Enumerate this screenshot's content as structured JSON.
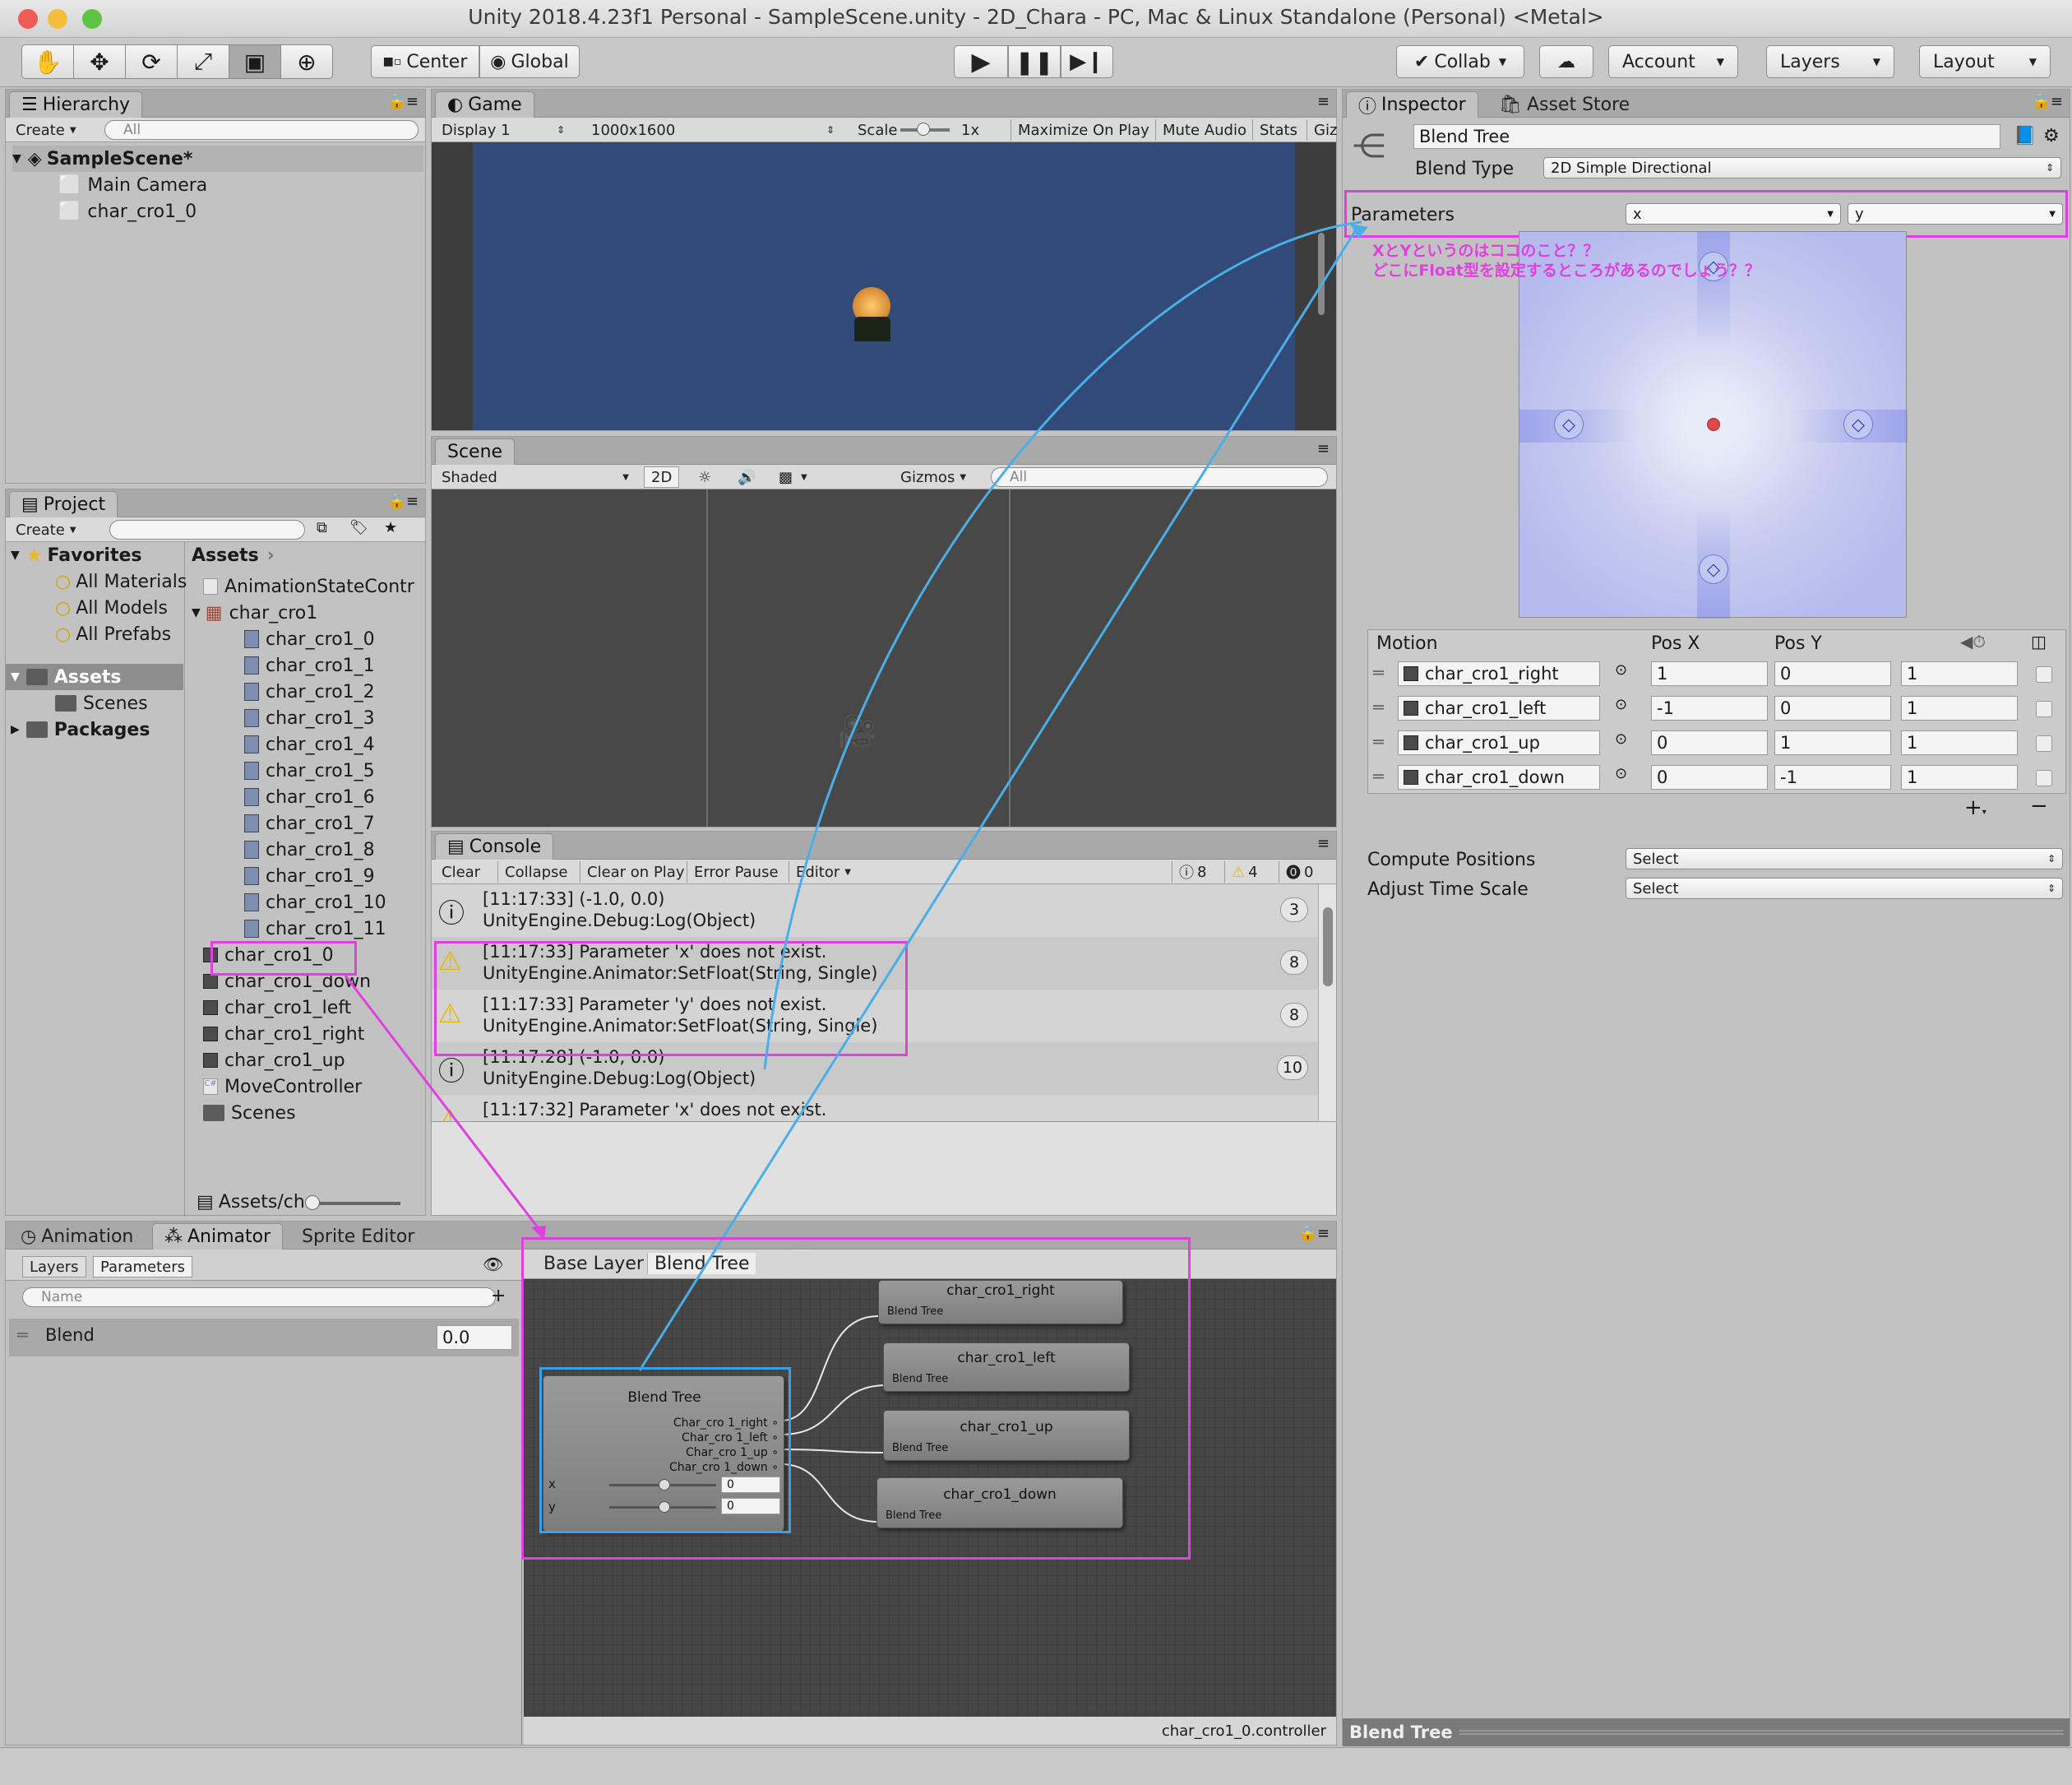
{
  "window": {
    "title": "Unity 2018.4.23f1 Personal - SampleScene.unity - 2D_Chara - PC, Mac & Linux Standalone (Personal) <Metal>"
  },
  "toolbar": {
    "center": "Center",
    "global": "Global",
    "collab": "Collab",
    "account": "Account",
    "layers": "Layers",
    "layout": "Layout"
  },
  "hierarchy": {
    "tab": "Hierarchy",
    "create": "Create",
    "search_placeholder": "All",
    "scene": "SampleScene*",
    "items": [
      "Main Camera",
      "char_cro1_0"
    ]
  },
  "game": {
    "tab": "Game",
    "display": "Display 1",
    "resolution": "1000x1600",
    "scale_label": "Scale",
    "scale_value": "1x",
    "maximize": "Maximize On Play",
    "mute": "Mute Audio",
    "stats": "Stats",
    "gizmos": "Giz"
  },
  "scene": {
    "tab": "Scene",
    "shading": "Shaded",
    "mode2d": "2D",
    "gizmos": "Gizmos",
    "search_placeholder": "All"
  },
  "project": {
    "tab": "Project",
    "create": "Create",
    "favorites": "Favorites",
    "fav_items": [
      "All Materials",
      "All Models",
      "All Prefabs"
    ],
    "assets": "Assets",
    "scenes": "Scenes",
    "packages": "Packages",
    "breadcrumb": "Assets",
    "footer": "Assets/ch",
    "files": {
      "controller_top": "AnimationStateContr",
      "sheet": "char_cro1",
      "sprites": [
        "char_cro1_0",
        "char_cro1_1",
        "char_cro1_2",
        "char_cro1_3",
        "char_cro1_4",
        "char_cro1_5",
        "char_cro1_6",
        "char_cro1_7",
        "char_cro1_8",
        "char_cro1_9",
        "char_cro1_10",
        "char_cro1_11"
      ],
      "controller": "char_cro1_0",
      "anims": [
        "char_cro1_down",
        "char_cro1_left",
        "char_cro1_right",
        "char_cro1_up"
      ],
      "script": "MoveController",
      "scenes": "Scenes"
    }
  },
  "console": {
    "tab": "Console",
    "clear": "Clear",
    "collapse": "Collapse",
    "clear_on_play": "Clear on Play",
    "error_pause": "Error Pause",
    "editor": "Editor",
    "count_info": "8",
    "count_warn": "4",
    "count_err": "0",
    "entries": [
      {
        "line1": "[11:17:33] (-1.0, 0.0)",
        "line2": "UnityEngine.Debug:Log(Object)",
        "count": "3",
        "kind": "info"
      },
      {
        "line1": "[11:17:33] Parameter 'x' does not exist.",
        "line2": "UnityEngine.Animator:SetFloat(String, Single)",
        "count": "8",
        "kind": "warn"
      },
      {
        "line1": "[11:17:33] Parameter 'y' does not exist.",
        "line2": "UnityEngine.Animator:SetFloat(String, Single)",
        "count": "8",
        "kind": "warn"
      },
      {
        "line1": "[11:17:28] (-1.0, 0.0)",
        "line2": "UnityEngine.Debug:Log(Object)",
        "count": "10",
        "kind": "info"
      },
      {
        "line1": "[11:17:32] Parameter 'x' does not exist.",
        "line2": "",
        "count": "",
        "kind": "warn"
      }
    ]
  },
  "inspector": {
    "tab": "Inspector",
    "asset_store": "Asset Store",
    "name": "Blend Tree",
    "blend_type_label": "Blend Type",
    "blend_type": "2D Simple Directional",
    "parameters_label": "Parameters",
    "param_x": "x",
    "param_y": "y",
    "annotation_line1": "XとYというのはココのこと？？",
    "annotation_line2": "どこにFloat型を設定するところがあるのでしょう？？",
    "motion_header": "Motion",
    "posx_header": "Pos X",
    "posy_header": "Pos Y",
    "motions": [
      {
        "name": "char_cro1_right",
        "x": "1",
        "y": "0",
        "speed": "1"
      },
      {
        "name": "char_cro1_left",
        "x": "-1",
        "y": "0",
        "speed": "1"
      },
      {
        "name": "char_cro1_up",
        "x": "0",
        "y": "1",
        "speed": "1"
      },
      {
        "name": "char_cro1_down",
        "x": "0",
        "y": "-1",
        "speed": "1"
      }
    ],
    "compute_label": "Compute Positions",
    "compute_value": "Select",
    "adjust_label": "Adjust Time Scale",
    "adjust_value": "Select",
    "footer": "Blend Tree"
  },
  "animator": {
    "tab_animation": "Animation",
    "tab_animator": "Animator",
    "tab_sprite": "Sprite Editor",
    "layers": "Layers",
    "parameters": "Parameters",
    "search_placeholder": "Name",
    "param_name": "Blend",
    "param_value": "0.0",
    "crumb_base": "Base Layer",
    "crumb_tree": "Blend Tree",
    "footer": "char_cro1_0.controller",
    "main_node": {
      "title": "Blend Tree",
      "outputs": [
        "Char_cro 1_right",
        "Char_cro 1_left",
        "Char_cro 1_up",
        "Char_cro 1_down"
      ],
      "x_label": "x",
      "x_value": "0",
      "y_label": "y",
      "y_value": "0"
    },
    "child_nodes": [
      {
        "title": "char_cro1_right",
        "sub": "Blend Tree"
      },
      {
        "title": "char_cro1_left",
        "sub": "Blend Tree"
      },
      {
        "title": "char_cro1_up",
        "sub": "Blend Tree"
      },
      {
        "title": "char_cro1_down",
        "sub": "Blend Tree"
      }
    ]
  }
}
